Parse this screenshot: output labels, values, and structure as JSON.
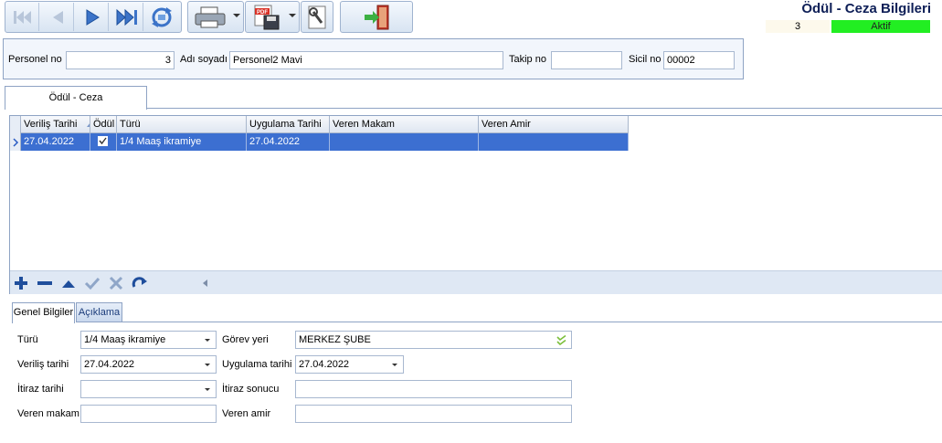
{
  "header": {
    "title": "Ödül - Ceza Bilgileri",
    "record_no": "3",
    "status": "Aktif",
    "status_color": "#22ee22"
  },
  "toolbar": {
    "nav_buttons": [
      "first-record-icon",
      "previous-record-icon",
      "next-record-icon",
      "last-record-icon",
      "refresh-icon"
    ],
    "print_icon": "printer-icon",
    "pdf_icon": "pdf-save-icon",
    "tools_icon": "tools-icon",
    "exit_icon": "exit-door-icon"
  },
  "filter": {
    "personel_no_label": "Personel no",
    "personel_no_value": "3",
    "adi_soyadi_label": "Adı soyadı",
    "adi_soyadi_value": "Personel2 Mavi",
    "takip_no_label": "Takip no",
    "takip_no_value": "",
    "sicil_no_label": "Sicil no",
    "sicil_no_value": "00002"
  },
  "main_tab": {
    "label": "Ödül - Ceza"
  },
  "grid": {
    "columns": [
      "Veriliş Tarihi",
      "Ödül",
      "Türü",
      "Uygulama Tarihi",
      "Veren Makam",
      "Veren Amir"
    ],
    "rows": [
      {
        "verilis_tarihi": "27.04.2022",
        "odul": true,
        "turu": "1/4 Maaş ikramiye",
        "uygulama_tarihi": "27.04.2022",
        "veren_makam": "",
        "veren_amir": ""
      }
    ],
    "selected_row_color": "#3c6fd1"
  },
  "detail_tabs": [
    {
      "label": "Genel Bilgiler",
      "active": true
    },
    {
      "label": "Açıklama",
      "active": false
    }
  ],
  "detail": {
    "turu_label": "Türü",
    "turu_value": "1/4 Maaş ikramiye",
    "gorev_yeri_label": "Görev yeri",
    "gorev_yeri_value": "MERKEZ ŞUBE",
    "verilis_tarihi_label": "Veriliş tarihi",
    "verilis_tarihi_value": "27.04.2022",
    "uygulama_tarihi_label": "Uygulama tarihi",
    "uygulama_tarihi_value": "27.04.2022",
    "itiraz_tarihi_label": "İtiraz tarihi",
    "itiraz_tarihi_value": "",
    "itiraz_sonucu_label": "İtiraz sonucu",
    "itiraz_sonucu_value": "",
    "veren_makam_label": "Veren makam",
    "veren_makam_value": "",
    "veren_amir_label": "Veren amir",
    "veren_amir_value": ""
  }
}
